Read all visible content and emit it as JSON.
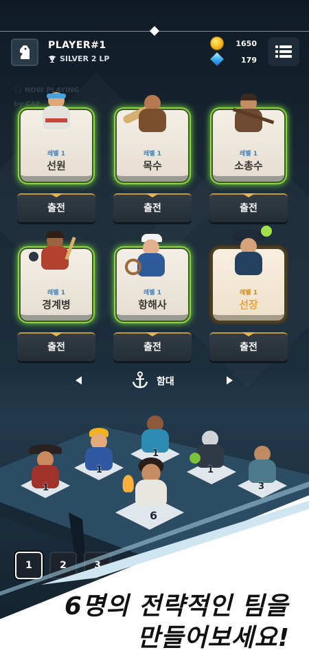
{
  "header": {
    "player_name": "PLAYER#1",
    "rank": "SILVER 2 LP",
    "coins": "1650",
    "gems": "179",
    "icons": {
      "avatar": "chess-knight-icon",
      "rank": "trophy-icon",
      "coin": "coin-icon",
      "gem": "gem-icon",
      "menu": "list-menu-icon"
    }
  },
  "now_playing": {
    "label": "NOW PLAYING",
    "by": "by CAF"
  },
  "crew": [
    {
      "level": "레벨 1",
      "name": "선원",
      "deploy": "출전",
      "style": "green"
    },
    {
      "level": "레벨 1",
      "name": "목수",
      "deploy": "출전",
      "style": "green"
    },
    {
      "level": "레벨 1",
      "name": "소총수",
      "deploy": "출전",
      "style": "green"
    },
    {
      "level": "레벨 1",
      "name": "경계병",
      "deploy": "출전",
      "style": "green"
    },
    {
      "level": "레벨 1",
      "name": "항해사",
      "deploy": "출전",
      "style": "green"
    },
    {
      "level": "레벨 1",
      "name": "선장",
      "deploy": "출전",
      "style": "gold"
    }
  ],
  "fleet": {
    "label": "함대"
  },
  "board": {
    "counts": [
      "1",
      "1",
      "1",
      "1",
      "3",
      "6"
    ]
  },
  "teams": [
    "1",
    "2",
    "3"
  ],
  "promo": {
    "line1": "6명의 전략적인 팀을",
    "line2": "만들어보세요!"
  },
  "colors": {
    "active_glow": "#7ae13a",
    "gold_accent": "#e8a33d",
    "level_blue": "#4a7eab"
  }
}
